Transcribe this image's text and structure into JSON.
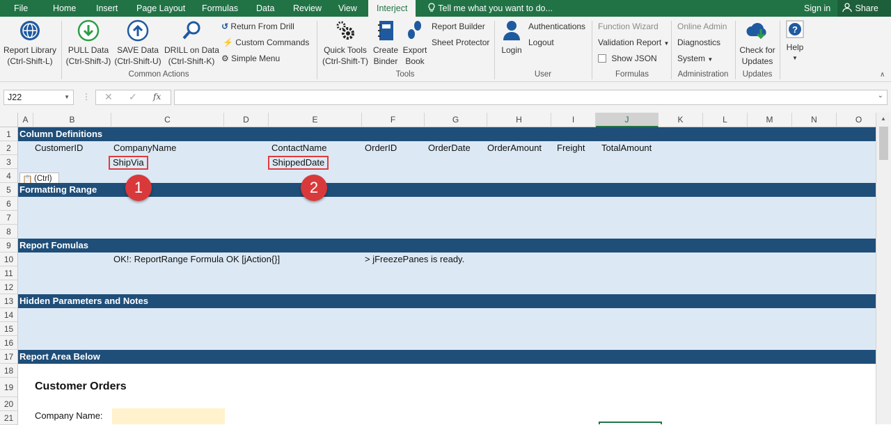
{
  "tabs": {
    "file": "File",
    "home": "Home",
    "insert": "Insert",
    "page_layout": "Page Layout",
    "formulas": "Formulas",
    "data": "Data",
    "review": "Review",
    "view": "View",
    "interject": "Interject",
    "tell_me": "Tell me what you want to do...",
    "sign_in": "Sign in",
    "share": "Share"
  },
  "ribbon": {
    "report_library": [
      "Report Library",
      "(Ctrl-Shift-L)"
    ],
    "pull_data": [
      "PULL Data",
      "(Ctrl-Shift-J)"
    ],
    "save_data": [
      "SAVE Data",
      "(Ctrl-Shift-U)"
    ],
    "drill_data": [
      "DRILL on Data",
      "(Ctrl-Shift-K)"
    ],
    "return_from_drill": "Return From Drill",
    "custom_commands": "Custom Commands",
    "simple_menu": "Simple Menu",
    "quick_tools": [
      "Quick Tools",
      "(Ctrl-Shift-T)"
    ],
    "create_binder": [
      "Create",
      "Binder"
    ],
    "export_book": [
      "Export",
      "Book"
    ],
    "report_builder": "Report Builder",
    "sheet_protector": "Sheet Protector",
    "login": "Login",
    "authentications": "Authentications",
    "logout": "Logout",
    "function_wizard": "Function Wizard",
    "validation_report": "Validation Report",
    "show_json": "Show JSON",
    "online_admin": "Online Admin",
    "diagnostics": "Diagnostics",
    "system": "System",
    "check_updates": [
      "Check for",
      "Updates"
    ],
    "help": "Help",
    "groups": {
      "common_actions": "Common Actions",
      "tools": "Tools",
      "user": "User",
      "formulas": "Formulas",
      "administration": "Administration",
      "updates": "Updates"
    }
  },
  "formula_bar": {
    "name_box": "J22",
    "fx": "fx",
    "formula": ""
  },
  "columns": [
    "A",
    "B",
    "C",
    "D",
    "E",
    "F",
    "G",
    "H",
    "I",
    "J",
    "K",
    "L",
    "M",
    "N",
    "O"
  ],
  "selected_column": "J",
  "rows": [
    "1",
    "2",
    "3",
    "4",
    "5",
    "6",
    "7",
    "8",
    "9",
    "10",
    "11",
    "12",
    "13",
    "14",
    "15",
    "16",
    "17",
    "18",
    "19",
    "20",
    "21"
  ],
  "sections": {
    "column_definitions": "Column Definitions",
    "formatting_range": "Formatting Range",
    "report_formulas": "Report Fomulas",
    "hidden_parameters": "Hidden Parameters and Notes",
    "report_area": "Report Area Below"
  },
  "column_defs_row2": {
    "customer_id": "CustomerID",
    "company_name": "CompanyName",
    "contact_name": "ContactName",
    "order_id": "OrderID",
    "order_date": "OrderDate",
    "order_amount": "OrderAmount",
    "freight": "Freight",
    "total_amount": "TotalAmount"
  },
  "column_defs_row3": {
    "ship_via": "ShipVia",
    "shipped_date": "ShippedDate"
  },
  "callouts": {
    "one": "1",
    "two": "2"
  },
  "paste_options": "(Ctrl)",
  "report_formulas_row10": {
    "status": "OK!: ReportRange Formula OK [jAction{}]",
    "freeze": "> jFreezePanes is ready."
  },
  "report": {
    "title": "Customer Orders",
    "company_label": "Company Name:"
  },
  "colors": {
    "excel_green": "#217346",
    "section_dark": "#1f4e79",
    "section_light": "#dce9f5",
    "callout_red": "#d9393a",
    "input_fill": "#fff2cc"
  }
}
